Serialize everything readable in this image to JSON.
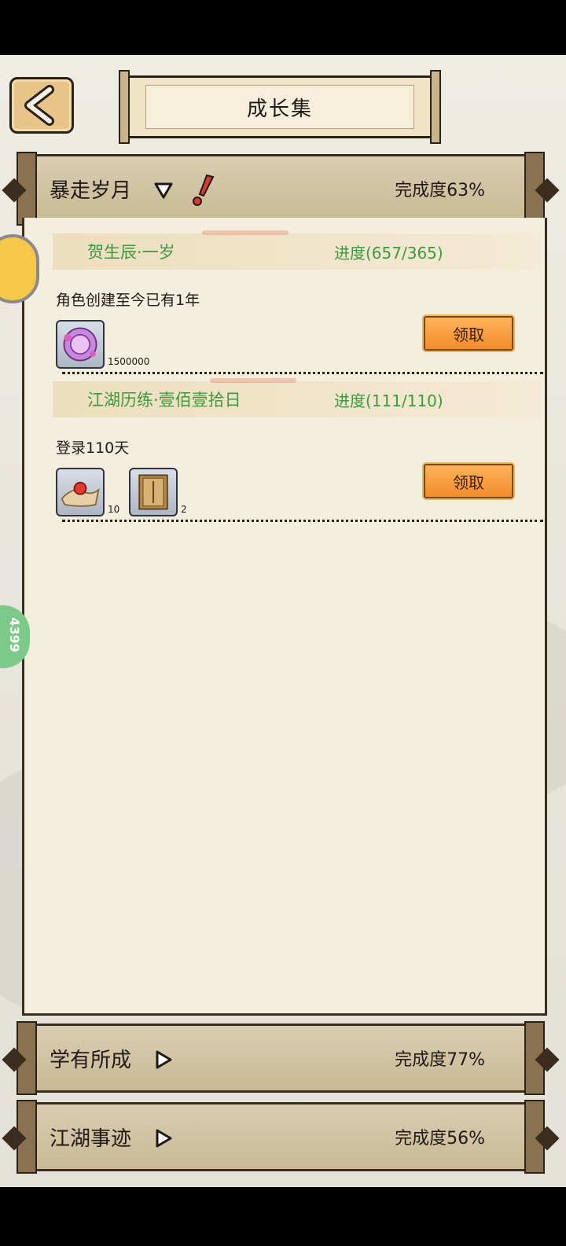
{
  "header": {
    "title": "成长集"
  },
  "sections": [
    {
      "title": "暴走岁月",
      "completion": "完成度63%",
      "expanded": true
    },
    {
      "title": "学有所成",
      "completion": "完成度77%",
      "expanded": false
    },
    {
      "title": "江湖事迹",
      "completion": "完成度56%",
      "expanded": false
    }
  ],
  "tasks": [
    {
      "name": "贺生辰·一岁",
      "progress": "进度(657/365)",
      "description": "角色创建至今已有1年",
      "rewards": [
        {
          "icon": "purple-orb-icon",
          "count": "1500000"
        }
      ],
      "claim_label": "领取"
    },
    {
      "name": "江湖历练·壹佰壹拾日",
      "progress": "进度(111/110)",
      "description": "登录110天",
      "rewards": [
        {
          "icon": "red-pearl-icon",
          "count": "10"
        },
        {
          "icon": "book-icon",
          "count": "2"
        }
      ],
      "claim_label": "领取"
    }
  ],
  "side": {
    "green_badge_text": "4399"
  },
  "colors": {
    "task_green": "#3c9a3f",
    "claim_orange": "#f28c2c",
    "alert_red": "#d93a2b"
  }
}
